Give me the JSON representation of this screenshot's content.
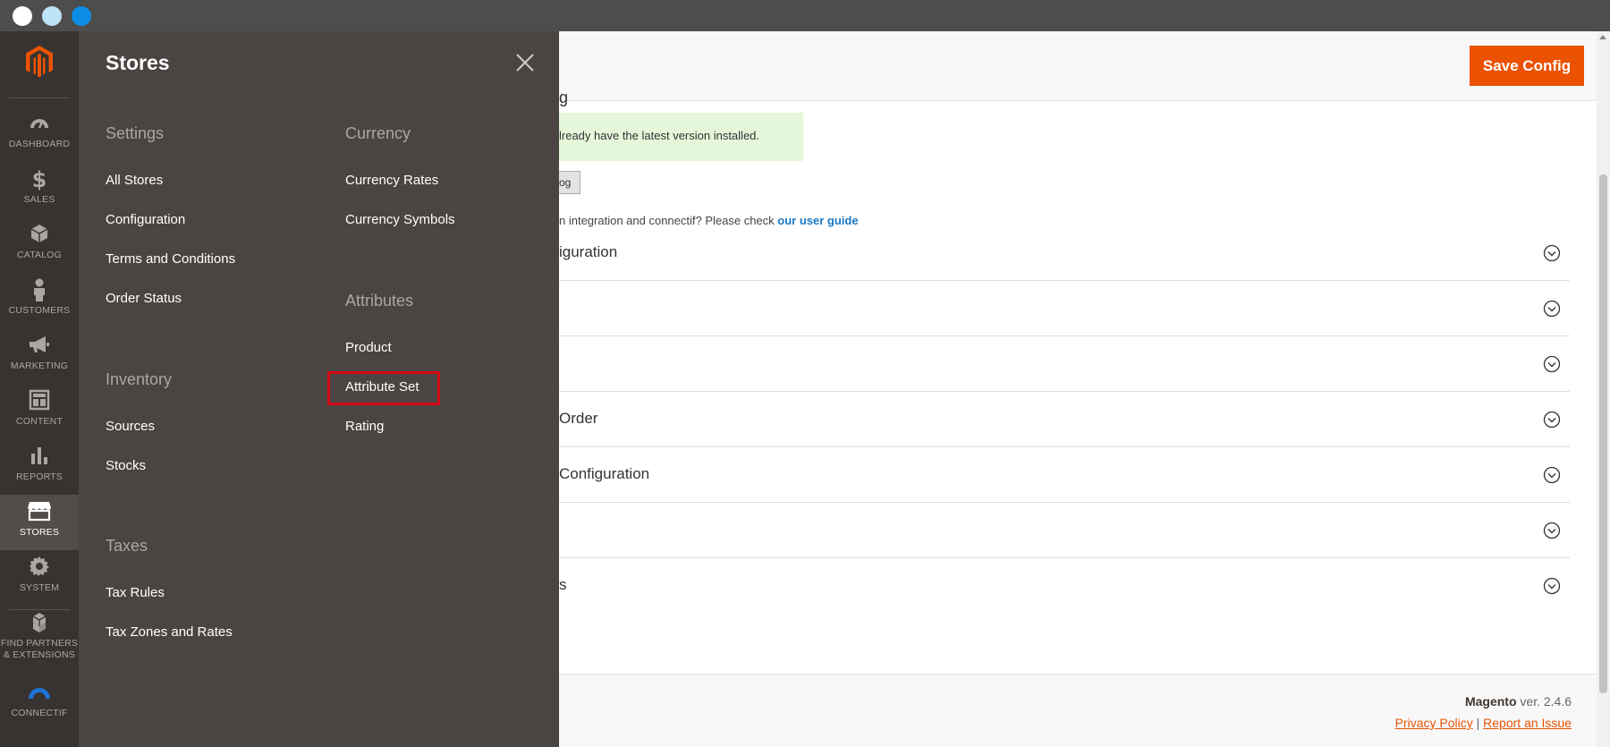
{
  "window": {
    "traffic_colors": [
      "#ffffff",
      "#bfe3f7",
      "#0c8de6"
    ]
  },
  "leftnav": {
    "items": [
      {
        "label": "DASHBOARD",
        "icon": "dashboard-icon"
      },
      {
        "label": "SALES",
        "icon": "dollar-icon"
      },
      {
        "label": "CATALOG",
        "icon": "box-icon"
      },
      {
        "label": "CUSTOMERS",
        "icon": "person-icon"
      },
      {
        "label": "MARKETING",
        "icon": "megaphone-icon"
      },
      {
        "label": "CONTENT",
        "icon": "layout-icon"
      },
      {
        "label": "REPORTS",
        "icon": "bar-chart-icon"
      },
      {
        "label": "STORES",
        "icon": "storefront-icon",
        "active": true
      },
      {
        "label": "SYSTEM",
        "icon": "gear-icon"
      },
      {
        "label": "FIND PARTNERS",
        "label2": "& EXTENSIONS",
        "icon": "cubes-icon"
      },
      {
        "label": "CONNECTIF",
        "icon": "connectif-logo-icon"
      }
    ]
  },
  "flyout": {
    "title": "Stores",
    "settings": {
      "title": "Settings",
      "links": [
        "All Stores",
        "Configuration",
        "Terms and Conditions",
        "Order Status"
      ]
    },
    "inventory": {
      "title": "Inventory",
      "links": [
        "Sources",
        "Stocks"
      ]
    },
    "taxes": {
      "title": "Taxes",
      "links": [
        "Tax Rules",
        "Tax Zones and Rates"
      ]
    },
    "currency": {
      "title": "Currency",
      "links": [
        "Currency Rates",
        "Currency Symbols"
      ]
    },
    "attributes": {
      "title": "Attributes",
      "links": [
        "Product",
        "Attribute Set",
        "Rating"
      ]
    },
    "highlight_color": "#d60a16"
  },
  "main": {
    "save_label": "Save Config",
    "partial_heading": "g",
    "notice_text": "lready have the latest version installed.",
    "partial_button": "og",
    "guide_prefix": "n integration and connectif? Please check ",
    "guide_link": "our user guide",
    "sections": [
      {
        "title": "iguration"
      },
      {
        "title": ""
      },
      {
        "title": ""
      },
      {
        "title": "Order"
      },
      {
        "title": "Configuration"
      },
      {
        "title": ""
      },
      {
        "title": "s"
      }
    ],
    "footer_brand": "Magento",
    "footer_version": " ver. 2.4.6",
    "privacy_link": "Privacy Policy",
    "separator": "|",
    "report_link": "Report an Issue",
    "accent_color": "#eb5202"
  }
}
